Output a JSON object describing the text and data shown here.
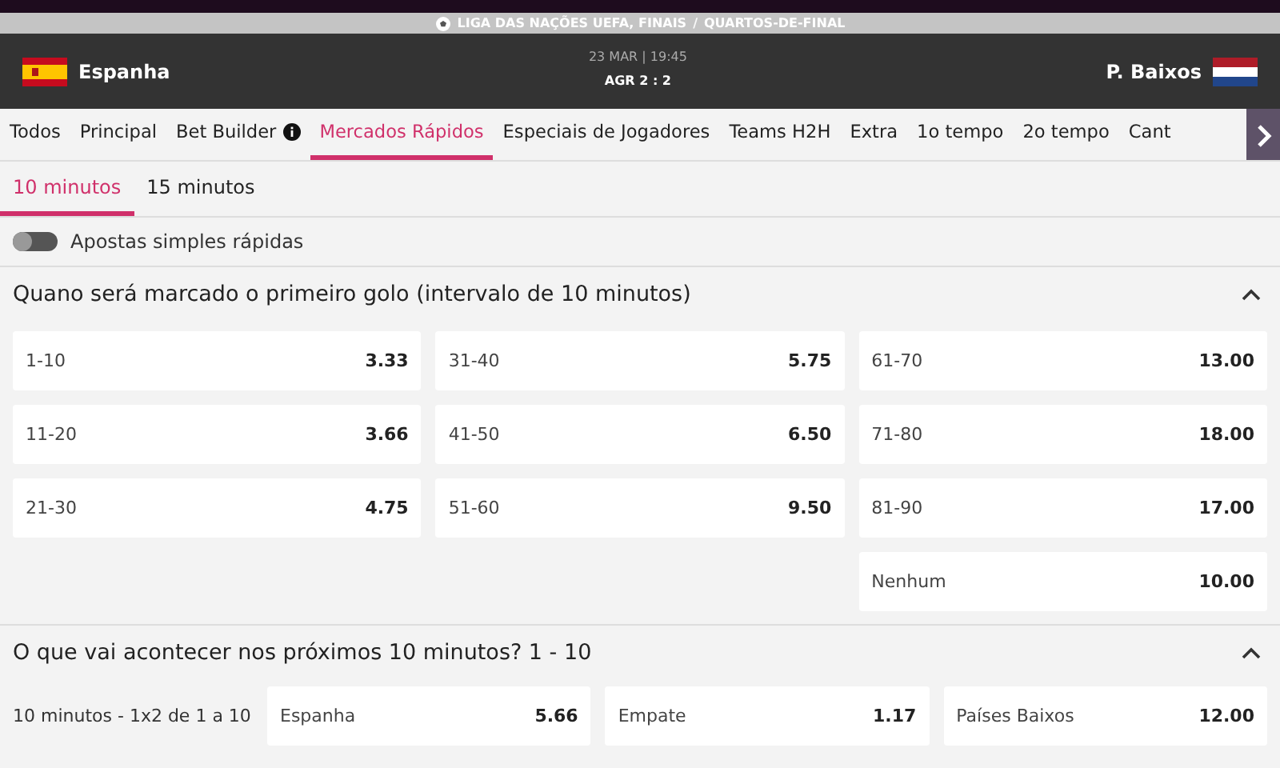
{
  "competition": "LIGA DAS NAÇÕES UEFA, FINAIS",
  "separator": "/",
  "stage": "QUARTOS-DE-FINAL",
  "match": {
    "datetime": "23 MAR | 19:45",
    "home": "Espanha",
    "away": "P. Baixos",
    "score": "AGR 2 : 2"
  },
  "tabs": [
    {
      "label": "Todos",
      "selected": false,
      "info": false
    },
    {
      "label": "Principal",
      "selected": false,
      "info": false
    },
    {
      "label": "Bet Builder",
      "selected": false,
      "info": true
    },
    {
      "label": "Mercados Rápidos",
      "selected": true,
      "info": false
    },
    {
      "label": "Especiais de Jogadores",
      "selected": false,
      "info": false
    },
    {
      "label": "Teams H2H",
      "selected": false,
      "info": false
    },
    {
      "label": "Extra",
      "selected": false,
      "info": false
    },
    {
      "label": "1o tempo",
      "selected": false,
      "info": false
    },
    {
      "label": "2o tempo",
      "selected": false,
      "info": false
    },
    {
      "label": "Cant",
      "selected": false,
      "info": false
    }
  ],
  "subtabs": [
    {
      "label": "10 minutos",
      "selected": true
    },
    {
      "label": "15 minutos",
      "selected": false
    }
  ],
  "quick_bets": {
    "label": "Apostas simples rápidas",
    "on": false
  },
  "markets": [
    {
      "title": "Quano será marcado o primeiro golo (intervalo de 10 minutos)",
      "expanded": true,
      "kind": "grid",
      "outcomes": [
        {
          "label": "1-10",
          "odds": "3.33"
        },
        {
          "label": "31-40",
          "odds": "5.75"
        },
        {
          "label": "61-70",
          "odds": "13.00"
        },
        {
          "label": "11-20",
          "odds": "3.66"
        },
        {
          "label": "41-50",
          "odds": "6.50"
        },
        {
          "label": "71-80",
          "odds": "18.00"
        },
        {
          "label": "21-30",
          "odds": "4.75"
        },
        {
          "label": "51-60",
          "odds": "9.50"
        },
        {
          "label": "81-90",
          "odds": "17.00"
        },
        {
          "label": "Nenhum",
          "odds": "10.00"
        }
      ]
    },
    {
      "title": "O que vai acontecer nos próximos 10 minutos? 1 - 10",
      "expanded": true,
      "kind": "row",
      "row_label": "10 minutos - 1x2 de 1 a 10",
      "outcomes": [
        {
          "label": "Espanha",
          "odds": "5.66"
        },
        {
          "label": "Empate",
          "odds": "1.17"
        },
        {
          "label": "Países Baixos",
          "odds": "12.00"
        }
      ]
    }
  ]
}
